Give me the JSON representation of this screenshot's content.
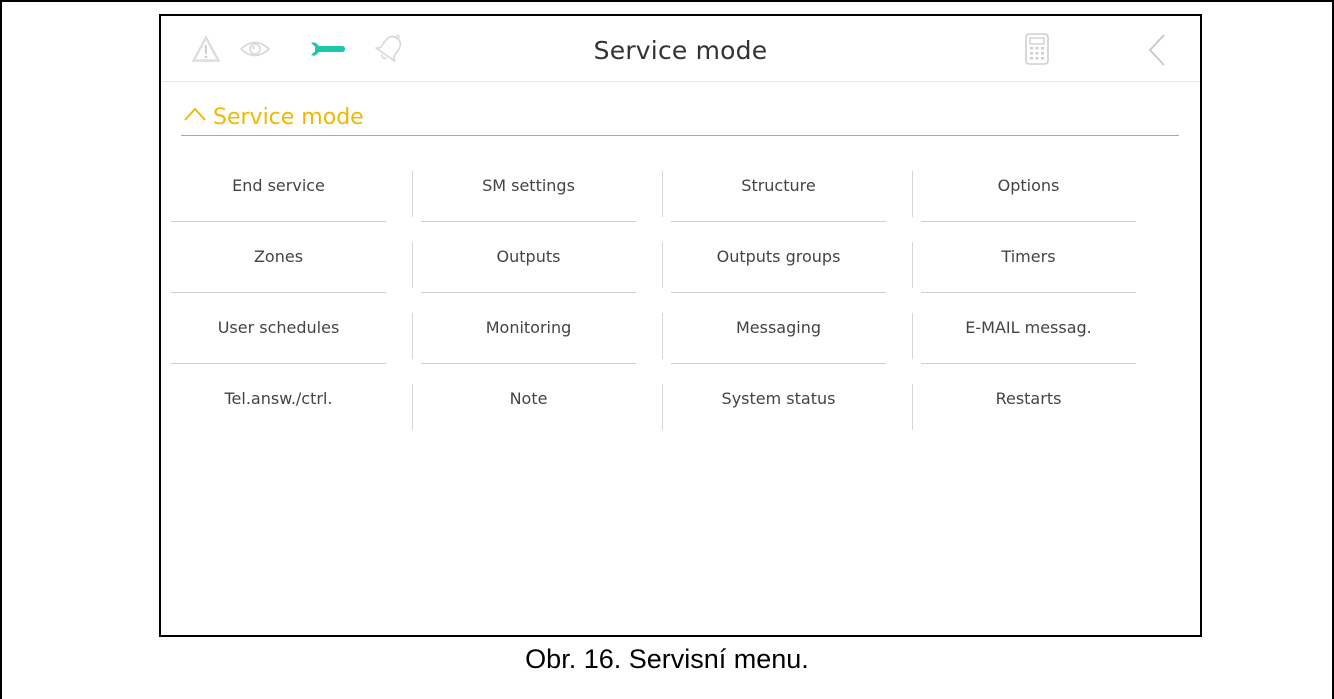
{
  "window": {
    "title": "Service mode",
    "accent_color": "#f2b800",
    "active_icon_color": "#1ec7a8"
  },
  "status_icons": [
    "warning-icon",
    "eye-icon",
    "wrench-icon",
    "bell-icon"
  ],
  "section": {
    "label": "Service mode",
    "expanded": true
  },
  "menu": {
    "rows": [
      [
        "End service",
        "SM settings",
        "Structure",
        "Options"
      ],
      [
        "Zones",
        "Outputs",
        "Outputs groups",
        "Timers"
      ],
      [
        "User schedules",
        "Monitoring",
        "Messaging",
        "E-MAIL messag."
      ],
      [
        "Tel.answ./ctrl.",
        "Note",
        "System status",
        "Restarts"
      ]
    ]
  },
  "caption": "Obr. 16. Servisní menu."
}
